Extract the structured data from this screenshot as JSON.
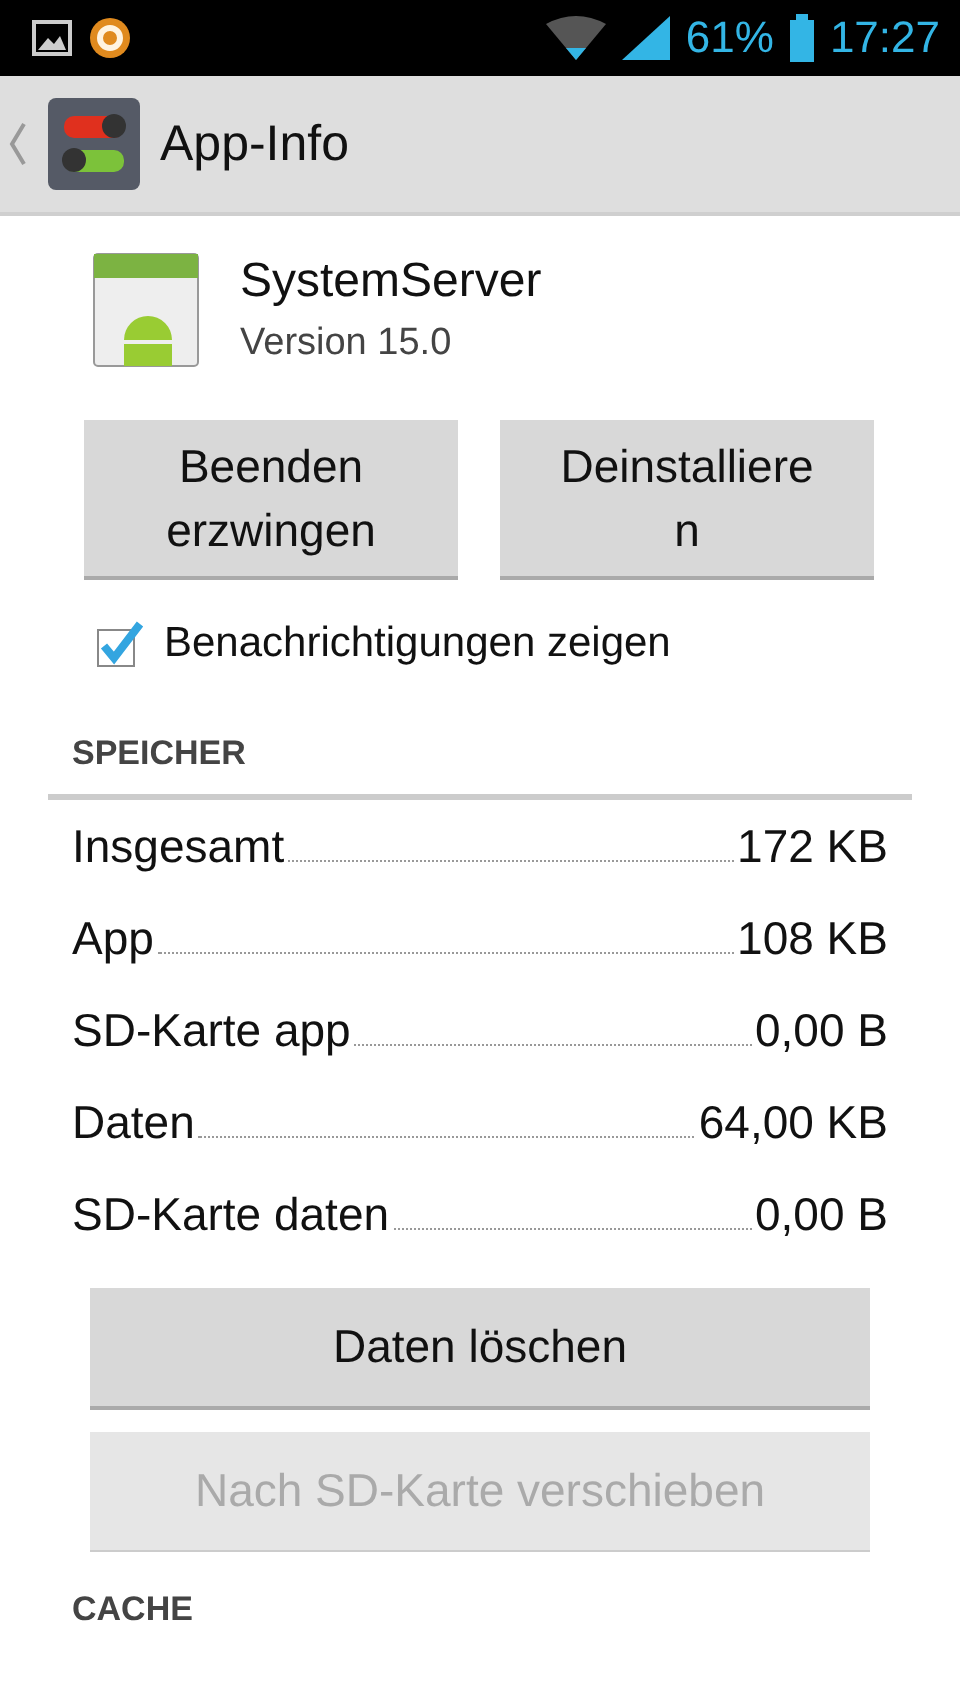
{
  "status_bar": {
    "battery_text": "61%",
    "time": "17:27"
  },
  "action_bar": {
    "title": "App-Info"
  },
  "app": {
    "name": "SystemServer",
    "version": "Version 15.0"
  },
  "buttons": [
    {
      "label": "Beenden\nerzwingen",
      "disabled": false
    },
    {
      "label": "Deinstalliere\nn",
      "disabled": false
    }
  ],
  "notifications": {
    "label": "Benachrichtigungen zeigen",
    "checked": true
  },
  "storage": {
    "header": "SPEICHER",
    "rows": [
      {
        "label": "Insgesamt",
        "value": "172 KB"
      },
      {
        "label": "App",
        "value": "108 KB"
      },
      {
        "label": "SD-Karte app",
        "value": "0,00 B"
      },
      {
        "label": "Daten",
        "value": "64,00 KB"
      },
      {
        "label": "SD-Karte daten",
        "value": "0,00 B"
      }
    ],
    "buttons": [
      {
        "label": "Daten löschen",
        "disabled": false
      },
      {
        "label": "Nach SD-Karte verschieben",
        "disabled": true
      }
    ]
  },
  "cache": {
    "header": "CACHE"
  }
}
